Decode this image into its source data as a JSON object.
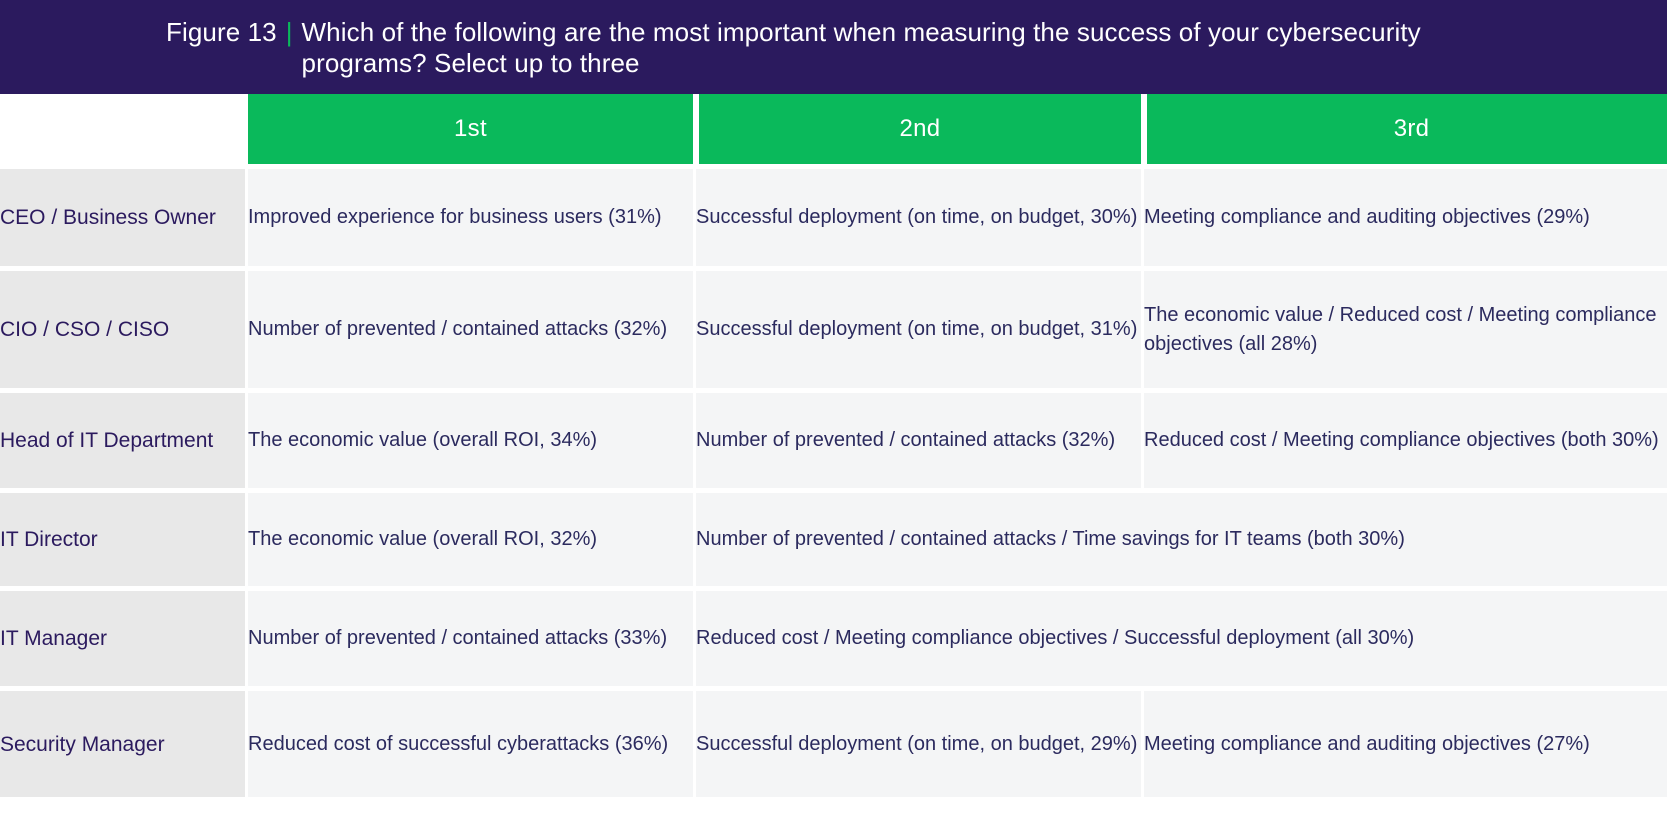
{
  "title": {
    "figure_number": "Figure 13",
    "separator": "|",
    "question": "Which of the following are the most important when measuring the success of your cybersecurity programs? Select up to three"
  },
  "colors": {
    "band_background": "#2b1a5e",
    "accent_green": "#0ab95b",
    "label_cell_background": "#e8e8e8",
    "data_cell_background": "#f4f5f6",
    "text_navy": "#2b1a5e"
  },
  "table": {
    "columns": [
      "",
      "1st",
      "2nd",
      "3rd"
    ],
    "rows": [
      {
        "label": "CEO / Business Owner",
        "first": "Improved experience for business users (31%)",
        "second": "Successful deployment (on time, on budget, 30%)",
        "third": "Meeting compliance and auditing objectives (29%)",
        "merged": false
      },
      {
        "label": "CIO / CSO / CISO",
        "first": "Number of prevented / contained attacks (32%)",
        "second": "Successful deployment (on time, on budget, 31%)",
        "third": "The economic value / Reduced cost / Meeting compliance objectives (all 28%)",
        "merged": false
      },
      {
        "label": "Head of IT Department",
        "first": "The economic value (overall ROI, 34%)",
        "second": "Number of prevented / contained attacks (32%)",
        "third": "Reduced cost / Meeting compliance objectives (both 30%)",
        "merged": false
      },
      {
        "label": "IT Director",
        "first": "The economic value (overall ROI, 32%)",
        "merged_text": "Number of prevented / contained attacks / Time savings for IT teams (both 30%)",
        "merged": true
      },
      {
        "label": "IT Manager",
        "first": "Number of prevented / contained attacks (33%)",
        "merged_text": "Reduced cost / Meeting compliance objectives / Successful deployment (all 30%)",
        "merged": true
      },
      {
        "label": "Security Manager",
        "first": "Reduced cost of successful cyberattacks (36%)",
        "second": "Successful deployment (on time, on budget, 29%)",
        "third": "Meeting compliance and auditing objectives (27%)",
        "merged": false
      }
    ]
  }
}
